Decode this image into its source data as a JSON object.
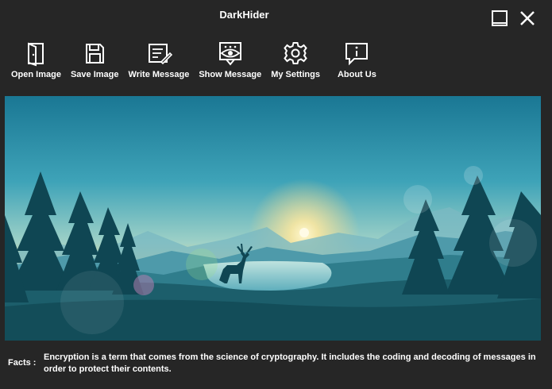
{
  "window": {
    "title": "DarkHider"
  },
  "titlebar": {
    "minimize_icon": "minimize-icon",
    "close_icon": "close-icon"
  },
  "toolbar": {
    "items": [
      {
        "label": "Open Image",
        "icon": "open-door-icon"
      },
      {
        "label": "Save Image",
        "icon": "floppy-disk-icon"
      },
      {
        "label": "Write Message",
        "icon": "write-document-icon"
      },
      {
        "label": "Show Message",
        "icon": "eye-message-icon"
      },
      {
        "label": "My Settings",
        "icon": "gear-icon"
      },
      {
        "label": "About Us",
        "icon": "info-bubble-icon"
      }
    ]
  },
  "image": {
    "description_colors": {
      "sky_top": "#1f7f9c",
      "sky_horizon": "#f3d98a",
      "forest": "#0e4a55"
    }
  },
  "facts": {
    "label": "Facts :",
    "text": "Encryption is a term that comes from the science of cryptography. It includes the coding and decoding of messages in order to protect their contents."
  },
  "colors": {
    "background": "#262626",
    "text": "#ffffff"
  }
}
